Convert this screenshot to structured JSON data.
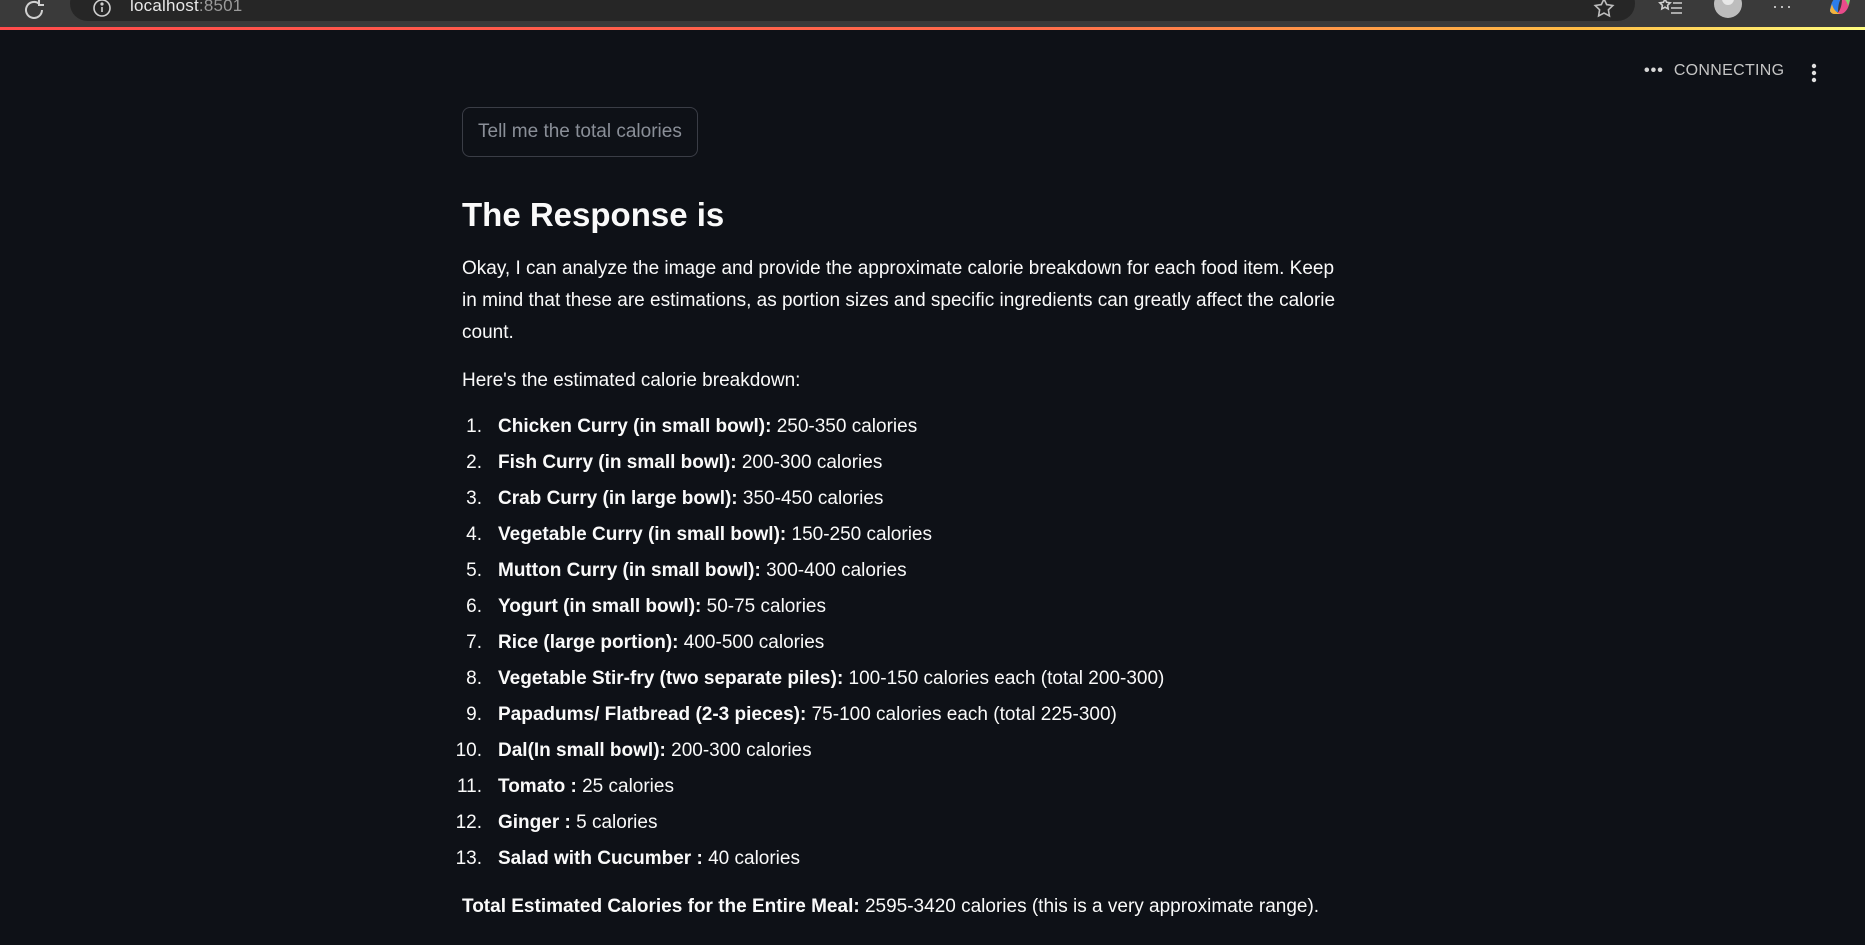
{
  "browser": {
    "url_host": "localhost",
    "url_port": ":8501",
    "icons": {
      "reload": "reload-icon",
      "info": "info-icon",
      "star": "star-icon",
      "favorites": "favorites-icon",
      "profile": "avatar",
      "more": "more-icon",
      "copilot": "copilot-icon"
    }
  },
  "app": {
    "status_text": "CONNECTING",
    "status_dots": "•••",
    "accent_color": "#ff4b4b",
    "background_color": "#0e1117"
  },
  "main": {
    "button_label": "Tell me the total calories",
    "heading": "The Response is",
    "intro": "Okay, I can analyze the image and provide the approximate calorie breakdown for each food item. Keep in mind that these are estimations, as portion sizes and specific ingredients can greatly affect the calorie count.",
    "lead": "Here's the estimated calorie breakdown:",
    "items": [
      {
        "num": "1.",
        "name": "Chicken Curry (in small bowl):",
        "value": " 250-350 calories"
      },
      {
        "num": "2.",
        "name": "Fish Curry (in small bowl):",
        "value": " 200-300 calories"
      },
      {
        "num": "3.",
        "name": "Crab Curry (in large bowl):",
        "value": " 350-450 calories"
      },
      {
        "num": "4.",
        "name": "Vegetable Curry (in small bowl):",
        "value": " 150-250 calories"
      },
      {
        "num": "5.",
        "name": "Mutton Curry (in small bowl):",
        "value": " 300-400 calories"
      },
      {
        "num": "6.",
        "name": "Yogurt (in small bowl):",
        "value": " 50-75 calories"
      },
      {
        "num": "7.",
        "name": "Rice (large portion):",
        "value": " 400-500 calories"
      },
      {
        "num": "8.",
        "name": "Vegetable Stir-fry (two separate piles):",
        "value": " 100-150 calories each (total 200-300)"
      },
      {
        "num": "9.",
        "name": "Papadums/ Flatbread (2-3 pieces):",
        "value": " 75-100 calories each (total 225-300)"
      },
      {
        "num": "10.",
        "name": "Dal(In small bowl):",
        "value": " 200-300 calories"
      },
      {
        "num": "11.",
        "name": "Tomato :",
        "value": " 25 calories"
      },
      {
        "num": "12.",
        "name": "Ginger :",
        "value": " 5 calories"
      },
      {
        "num": "13.",
        "name": "Salad with Cucumber :",
        "value": " 40 calories"
      }
    ],
    "total_label": "Total Estimated Calories for the Entire Meal:",
    "total_value": " 2595-3420 calories (this is a very approximate range)."
  }
}
